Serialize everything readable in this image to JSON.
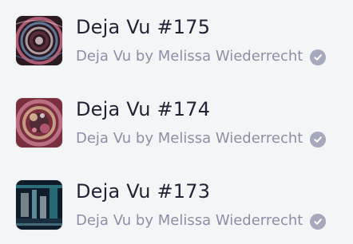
{
  "items": [
    {
      "title": "Deja Vu #175",
      "collection": "Deja Vu by Melissa Wiederrecht",
      "verified_icon": "check-circle-icon",
      "palette": [
        "#2b1a22",
        "#d06b8a",
        "#6c8fb8",
        "#e9d4d8",
        "#5a2d3d"
      ]
    },
    {
      "title": "Deja Vu #174",
      "collection": "Deja Vu by Melissa Wiederrecht",
      "verified_icon": "check-circle-icon",
      "palette": [
        "#7a2f3f",
        "#d98aa0",
        "#e8c9a0",
        "#4f2a35",
        "#b65c74"
      ]
    },
    {
      "title": "Deja Vu #173",
      "collection": "Deja Vu by Melissa Wiederrecht",
      "verified_icon": "check-circle-icon",
      "palette": [
        "#0f1c2a",
        "#3ea7b0",
        "#c7d8df",
        "#182d3d",
        "#7ab8c8"
      ]
    }
  ]
}
